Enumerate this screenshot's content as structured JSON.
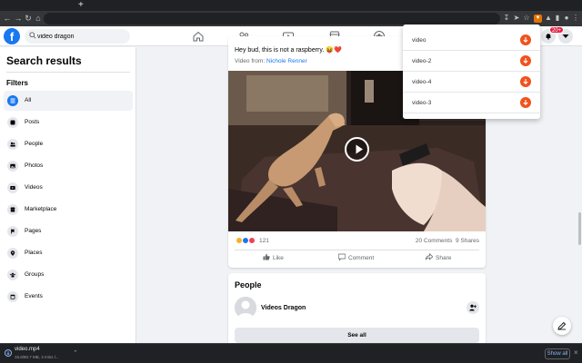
{
  "browser": {
    "new_tab_icon": "plus-icon",
    "back_icon": "back-arrow-icon",
    "forward_icon": "forward-arrow-icon",
    "reload_icon": "reload-icon",
    "home_icon": "home-icon",
    "url": "",
    "extensions": [
      "download-icon",
      "share-icon",
      "star-icon",
      "extension-orange-icon",
      "puzzle-icon",
      "sidebar-icon",
      "profile-icon",
      "menu-icon"
    ]
  },
  "facebook": {
    "logo": "f",
    "search_value": "video dragon",
    "nav_icons": [
      "home-icon",
      "friends-icon",
      "watch-icon",
      "marketplace-icon",
      "groups-icon"
    ],
    "notification_badge": "20+",
    "colors": {
      "brand": "#1877f2",
      "download_button": "#f0521c"
    }
  },
  "sidebar": {
    "title": "Search results",
    "filters_heading": "Filters",
    "filters": [
      {
        "label": "All",
        "icon": "all-icon",
        "active": true
      },
      {
        "label": "Posts",
        "icon": "posts-icon",
        "active": false
      },
      {
        "label": "People",
        "icon": "people-icon",
        "active": false
      },
      {
        "label": "Photos",
        "icon": "photos-icon",
        "active": false
      },
      {
        "label": "Videos",
        "icon": "videos-icon",
        "active": false
      },
      {
        "label": "Marketplace",
        "icon": "marketplace-icon",
        "active": false
      },
      {
        "label": "Pages",
        "icon": "pages-icon",
        "active": false
      },
      {
        "label": "Places",
        "icon": "places-icon",
        "active": false
      },
      {
        "label": "Groups",
        "icon": "groups-icon",
        "active": false
      },
      {
        "label": "Events",
        "icon": "events-icon",
        "active": false
      }
    ]
  },
  "post": {
    "caption": "Hey bud, this is not a raspberry. 😝❤️",
    "source_prefix": "Video from: ",
    "source_name": "Nichole Renner",
    "reaction_count": "121",
    "comments": "20 Comments",
    "shares": "9 Shares",
    "actions": {
      "like": "Like",
      "comment": "Comment",
      "share": "Share"
    }
  },
  "people": {
    "heading": "People",
    "person_name": "Videos Dragon",
    "see_all": "See all"
  },
  "dropdown": {
    "items": [
      {
        "label": "video"
      },
      {
        "label": "video-2"
      },
      {
        "label": "video-4"
      },
      {
        "label": "video-3"
      }
    ]
  },
  "download_bar": {
    "file_name": "video.mp4",
    "status": "15.6/80.7 MB, 3 mins l...",
    "show_all": "Show all"
  }
}
